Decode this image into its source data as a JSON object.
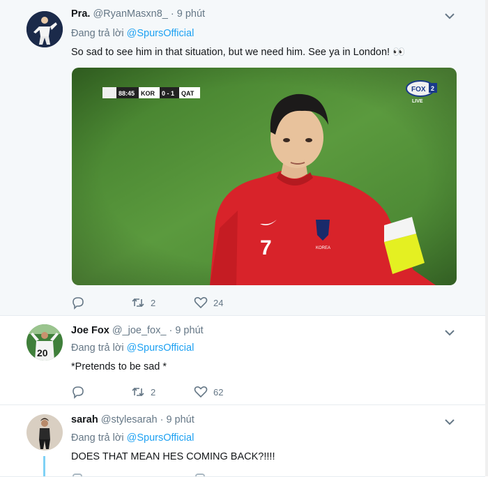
{
  "tweets": [
    {
      "name": "Pra.",
      "handle": "@RyanMasxn8_",
      "separator": "·",
      "time": "9 phút",
      "reply_prefix": "Đang trả lời",
      "reply_to": "@SpursOfficial",
      "text": "So sad to see him in that situation, but we need him. See ya in London! 👀",
      "retweets": "2",
      "likes": "24",
      "media": {
        "scoreboard_time": "88:45",
        "team_home": "KOR",
        "score": "0 - 1",
        "team_away": "QAT",
        "broadcaster": "FOX",
        "broadcaster_channel": "2",
        "live_label": "LIVE",
        "jersey_number": "7",
        "jersey_text": "KOREA"
      }
    },
    {
      "name": "Joe Fox",
      "handle": "@_joe_fox_",
      "separator": "·",
      "time": "9 phút",
      "reply_prefix": "Đang trả lời",
      "reply_to": "@SpursOfficial",
      "text": "*Pretends to be sad *",
      "retweets": "2",
      "likes": "62",
      "avatar_number": "20"
    },
    {
      "name": "sarah",
      "handle": "@stylesarah",
      "separator": "·",
      "time": "9 phút",
      "reply_prefix": "Đang trả lời",
      "reply_to": "@SpursOfficial",
      "text": "DOES THAT MEAN HES COMING BACK?!!!!"
    }
  ],
  "colors": {
    "link": "#1da1f2",
    "muted": "#657786",
    "text": "#14171a",
    "highlight_bg": "#f5f8fa",
    "jersey_red": "#d8232a",
    "pitch_green": "#4e8a34",
    "armband": "#e4f022"
  },
  "icons": [
    "chevron-down-icon",
    "reply-icon",
    "retweet-icon",
    "like-icon"
  ]
}
